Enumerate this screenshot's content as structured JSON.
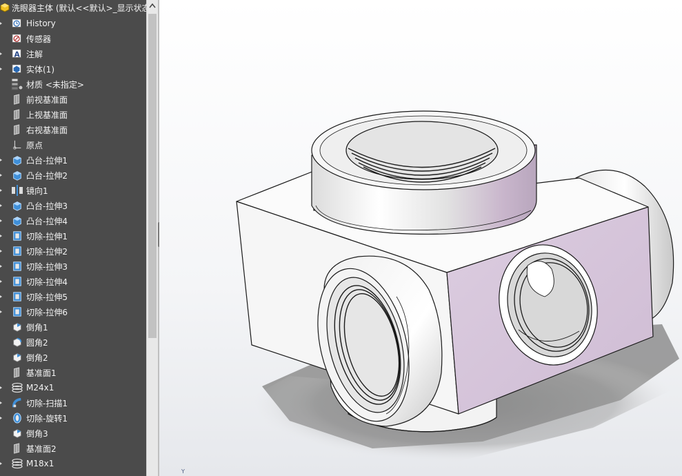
{
  "feature_tree": {
    "root_label": "洗眼器主体 (默认<<默认>_显示状态",
    "items": [
      {
        "label": "History",
        "icon": "history-icon",
        "expandable": true
      },
      {
        "label": "传感器",
        "icon": "sensor-icon",
        "expandable": false
      },
      {
        "label": "注解",
        "icon": "annotation-icon",
        "expandable": true
      },
      {
        "label": "实体(1)",
        "icon": "solid-bodies-icon",
        "expandable": true
      },
      {
        "label": "材质 <未指定>",
        "icon": "material-icon",
        "expandable": false
      },
      {
        "label": "前视基准面",
        "icon": "plane-icon",
        "expandable": false
      },
      {
        "label": "上视基准面",
        "icon": "plane-icon",
        "expandable": false
      },
      {
        "label": "右视基准面",
        "icon": "plane-icon",
        "expandable": false
      },
      {
        "label": "原点",
        "icon": "origin-icon",
        "expandable": false
      },
      {
        "label": "凸台-拉伸1",
        "icon": "boss-extrude-icon",
        "expandable": true
      },
      {
        "label": "凸台-拉伸2",
        "icon": "boss-extrude-icon",
        "expandable": true
      },
      {
        "label": "镜向1",
        "icon": "mirror-icon",
        "expandable": true
      },
      {
        "label": "凸台-拉伸3",
        "icon": "boss-extrude-icon",
        "expandable": true
      },
      {
        "label": "凸台-拉伸4",
        "icon": "boss-extrude-icon",
        "expandable": true
      },
      {
        "label": "切除-拉伸1",
        "icon": "cut-extrude-icon",
        "expandable": true
      },
      {
        "label": "切除-拉伸2",
        "icon": "cut-extrude-icon",
        "expandable": true
      },
      {
        "label": "切除-拉伸3",
        "icon": "cut-extrude-icon",
        "expandable": true
      },
      {
        "label": "切除-拉伸4",
        "icon": "cut-extrude-icon",
        "expandable": true
      },
      {
        "label": "切除-拉伸5",
        "icon": "cut-extrude-icon",
        "expandable": true
      },
      {
        "label": "切除-拉伸6",
        "icon": "cut-extrude-icon",
        "expandable": true
      },
      {
        "label": "倒角1",
        "icon": "chamfer-icon",
        "expandable": false
      },
      {
        "label": "圆角2",
        "icon": "fillet-icon",
        "expandable": false
      },
      {
        "label": "倒角2",
        "icon": "chamfer-icon",
        "expandable": false
      },
      {
        "label": "基准面1",
        "icon": "plane-icon",
        "expandable": false
      },
      {
        "label": "M24x1",
        "icon": "helix-icon",
        "expandable": true
      },
      {
        "label": "切除-扫描1",
        "icon": "cut-sweep-icon",
        "expandable": true
      },
      {
        "label": "切除-旋转1",
        "icon": "cut-revolve-icon",
        "expandable": true
      },
      {
        "label": "倒角3",
        "icon": "chamfer-icon",
        "expandable": false
      },
      {
        "label": "基准面2",
        "icon": "plane-icon",
        "expandable": false
      },
      {
        "label": "M18x1",
        "icon": "helix-icon",
        "expandable": true
      }
    ]
  },
  "viewport": {
    "axis_label": "Y",
    "model": "eyewash-body-part",
    "colors": {
      "background_top": "#ffffff",
      "background_bottom": "#d9dde3",
      "face": "#f2f2f2",
      "selected_face": "#d8c6dc",
      "edge": "#1a1a1a",
      "shadow": "#8c8c8c"
    }
  },
  "colors": {
    "tree_bg": "#4b4b4b",
    "tree_text": "#f2f2f2",
    "scrollbar": "#e8e8e8"
  }
}
